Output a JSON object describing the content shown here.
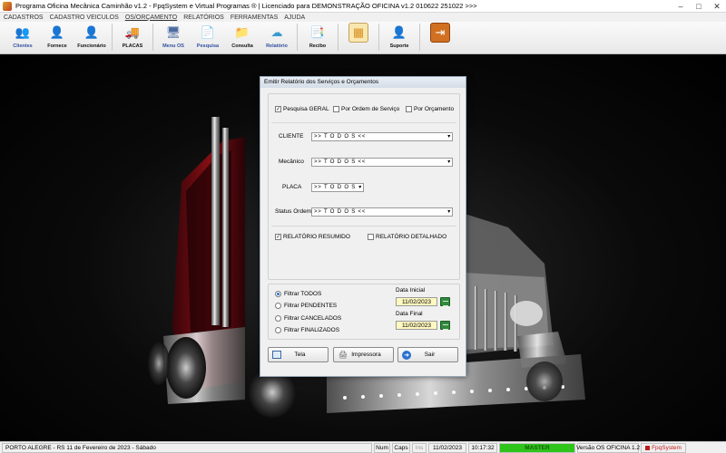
{
  "window": {
    "title": "Programa Oficina Mecânica Caminhão v1.2 - FpqSystem e Virtual Programas ® | Licenciado para  DEMONSTRAÇÃO OFICINA v1.2 010622 251022 >>>",
    "minimize": "–",
    "maximize": "□",
    "close": "✕"
  },
  "menu": [
    {
      "label": "CADASTROS"
    },
    {
      "label": "CADASTRO VEICULOS"
    },
    {
      "label": "OS/ORÇAMENTO"
    },
    {
      "label": "RELATÓRIOS"
    },
    {
      "label": "FERRAMENTAS"
    },
    {
      "label": "AJUDA"
    }
  ],
  "toolbar": [
    {
      "label": "Clientes",
      "icon": "clients-icon",
      "glyph": "👥"
    },
    {
      "label": "Fornece",
      "icon": "supplier-icon",
      "glyph": "👤"
    },
    {
      "label": "Funcionário",
      "icon": "employee-icon",
      "glyph": "👤"
    },
    {
      "label": "PLACAS",
      "icon": "truck-icon",
      "glyph": "🚚"
    },
    {
      "label": "Menu OS",
      "icon": "menu-os-icon",
      "glyph": "🖥"
    },
    {
      "label": "Pesquisa",
      "icon": "search-icon",
      "glyph": "📄"
    },
    {
      "label": "Consulta",
      "icon": "folder-icon",
      "glyph": "📁"
    },
    {
      "label": "Relatório",
      "icon": "report-icon",
      "glyph": "☁"
    },
    {
      "label": "Recibo",
      "icon": "receipt-icon",
      "glyph": "📑"
    },
    {
      "label": "",
      "icon": "calculator-icon",
      "glyph": "▦"
    },
    {
      "label": "Suporte",
      "icon": "support-icon",
      "glyph": "👤"
    },
    {
      "label": "",
      "icon": "exit-icon",
      "glyph": "⇥"
    }
  ],
  "dialog": {
    "title": "Emitir Relatório dos Serviços e Orçamentos",
    "search_mode": {
      "geral": "Pesquisa GERAL",
      "ordem_servico": "Por Ordem de Serviço",
      "orcamento": "Por Orçamento"
    },
    "cliente_label": "CLIENTE",
    "cliente_value": ">> T O D O S <<",
    "mecanico_label": "Mecânico",
    "mecanico_value": ">> T O D O S <<",
    "placa_label": "PLACA",
    "placa_value": ">> T O D O S",
    "status_label": "Status Ordem",
    "status_value": ">> T O D O S <<",
    "relatorio_resumido": "RELATÓRIO RESUMIDO",
    "relatorio_detalhado": "RELATÓRIO DETALHADO",
    "filters": [
      "Filtrar TODOS",
      "Filtrar PENDENTES",
      "Filtrar CANCELADOS",
      "Filtrar FINALIZADOS"
    ],
    "data_inicial_label": "Data Inicial",
    "data_inicial": "11/02/2023",
    "data_final_label": "Data Final",
    "data_final": "11/02/2023",
    "btn_tela": "Tela",
    "btn_impressora": "Impressora",
    "btn_sair": "Sair"
  },
  "status": {
    "location_date": "PORTO ALEGRE - RS 11 de Fevereiro de 2023 - Sábado",
    "num": "Num",
    "caps": "Caps",
    "ins": "Ins",
    "date": "11/02/2023",
    "time": "10:17:32",
    "master": "MASTER",
    "version": "Versão OS OFICINA 1.2",
    "brand": "FpqSystem"
  },
  "colors": {
    "accent_green": "#2ec41a",
    "date_bg": "#fff8c0",
    "truck_red": "#8a0e14"
  }
}
